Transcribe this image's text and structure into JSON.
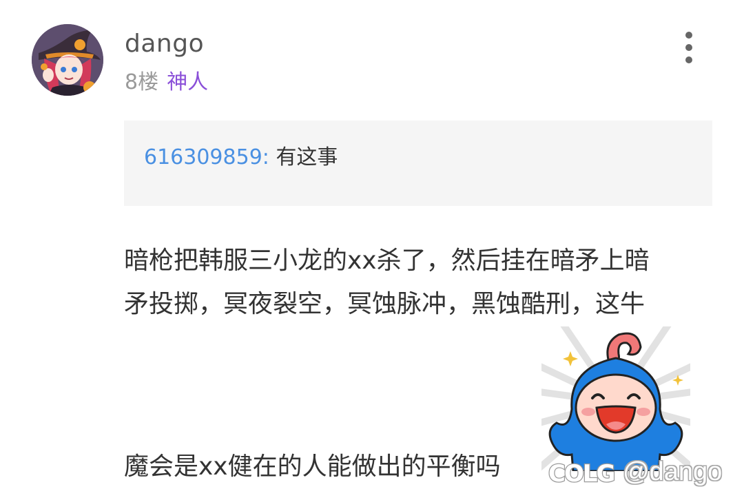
{
  "post": {
    "username": "dango",
    "floor": "8楼",
    "user_title": "神人",
    "quote": {
      "author": "616309859:",
      "text": "有这事"
    },
    "body_lines": [
      "暗枪把韩服三小龙的xx杀了，然后挂在暗矛上暗",
      "矛投掷，冥夜裂空，冥蚀脉冲，黑蚀酷刑，这牛",
      "魔会是xx健在的人能做出的平衡吗"
    ],
    "sticker": "blue-hooded-laughing-mascot",
    "watermark": {
      "logo_text": "COLG",
      "handle": "@dango"
    }
  },
  "icons": {
    "more": "more-vertical-icon"
  },
  "colors": {
    "username": "#555555",
    "floor": "#9a9a9a",
    "user_title": "#8a4fd8",
    "quote_author": "#4a90e2",
    "quote_background": "#f5f5f5",
    "body_text": "#333333",
    "sticker_blue": "#1e7fe0"
  }
}
